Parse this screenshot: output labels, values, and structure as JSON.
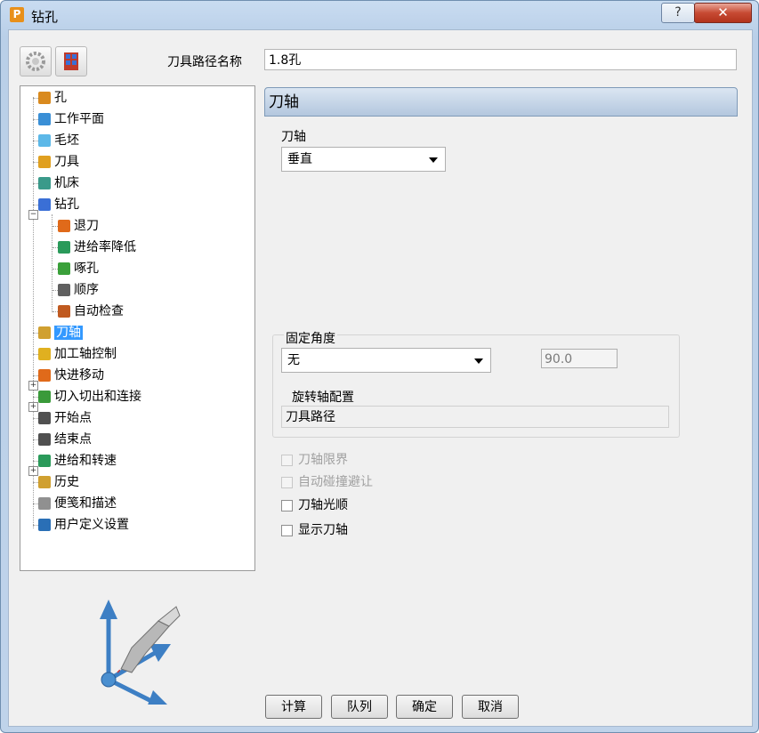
{
  "window": {
    "title": "钻孔",
    "app_icon_letter": "P",
    "help_symbol": "?",
    "close_symbol": "✕"
  },
  "toolbar": {
    "name_label": "刀具路径名称",
    "name_value": "1.8孔"
  },
  "tree": {
    "items": [
      {
        "label": "孔",
        "icon": "hole-icon",
        "color": "#d98a1e"
      },
      {
        "label": "工作平面",
        "icon": "workplane-icon",
        "color": "#3a8fd6"
      },
      {
        "label": "毛坯",
        "icon": "block-icon",
        "color": "#5cb8e8"
      },
      {
        "label": "刀具",
        "icon": "tool-icon",
        "color": "#e0a020"
      },
      {
        "label": "机床",
        "icon": "machine-icon",
        "color": "#3a9a8a"
      },
      {
        "label": "钻孔",
        "icon": "drilling-icon",
        "color": "#3a6fd6"
      },
      {
        "label": "退刀",
        "icon": "retract-icon",
        "color": "#e06a1a"
      },
      {
        "label": "进给率降低",
        "icon": "feed-reduce-icon",
        "color": "#2a9a5a"
      },
      {
        "label": "啄孔",
        "icon": "peck-icon",
        "color": "#3aa03a"
      },
      {
        "label": "顺序",
        "icon": "order-icon",
        "color": "#606060"
      },
      {
        "label": "自动检查",
        "icon": "auto-check-icon",
        "color": "#c05a20"
      },
      {
        "label": "刀轴",
        "icon": "tool-axis-icon",
        "color": "#d0a030"
      },
      {
        "label": "加工轴控制",
        "icon": "axis-control-icon",
        "color": "#e0b020"
      },
      {
        "label": "快进移动",
        "icon": "rapid-move-icon",
        "color": "#e06a1a"
      },
      {
        "label": "切入切出和连接",
        "icon": "leads-links-icon",
        "color": "#3a9a3a"
      },
      {
        "label": "开始点",
        "icon": "start-point-icon",
        "color": "#505050"
      },
      {
        "label": "结束点",
        "icon": "end-point-icon",
        "color": "#505050"
      },
      {
        "label": "进给和转速",
        "icon": "feeds-speeds-icon",
        "color": "#2a9a5a"
      },
      {
        "label": "历史",
        "icon": "history-icon",
        "color": "#d0a030"
      },
      {
        "label": "便笺和描述",
        "icon": "notes-icon",
        "color": "#909090"
      },
      {
        "label": "用户定义设置",
        "icon": "user-settings-icon",
        "color": "#2a6fb6"
      }
    ]
  },
  "panel": {
    "header": "刀轴",
    "axis_label": "刀轴",
    "axis_value": "垂直",
    "fixed_angle_label": "固定角度",
    "fixed_angle_value": "无",
    "angle_value": "90.0",
    "rotary_config_label": "旋转轴配置",
    "rotary_config_value": "刀具路径",
    "checkboxes": [
      {
        "label": "刀轴限界",
        "checked": false,
        "enabled": false
      },
      {
        "label": "自动碰撞避让",
        "checked": false,
        "enabled": false
      },
      {
        "label": "刀轴光顺",
        "checked": false,
        "enabled": true
      },
      {
        "label": "显示刀轴",
        "checked": false,
        "enabled": true
      }
    ]
  },
  "buttons": {
    "calculate": "计算",
    "queue": "队列",
    "ok": "确定",
    "cancel": "取消"
  }
}
